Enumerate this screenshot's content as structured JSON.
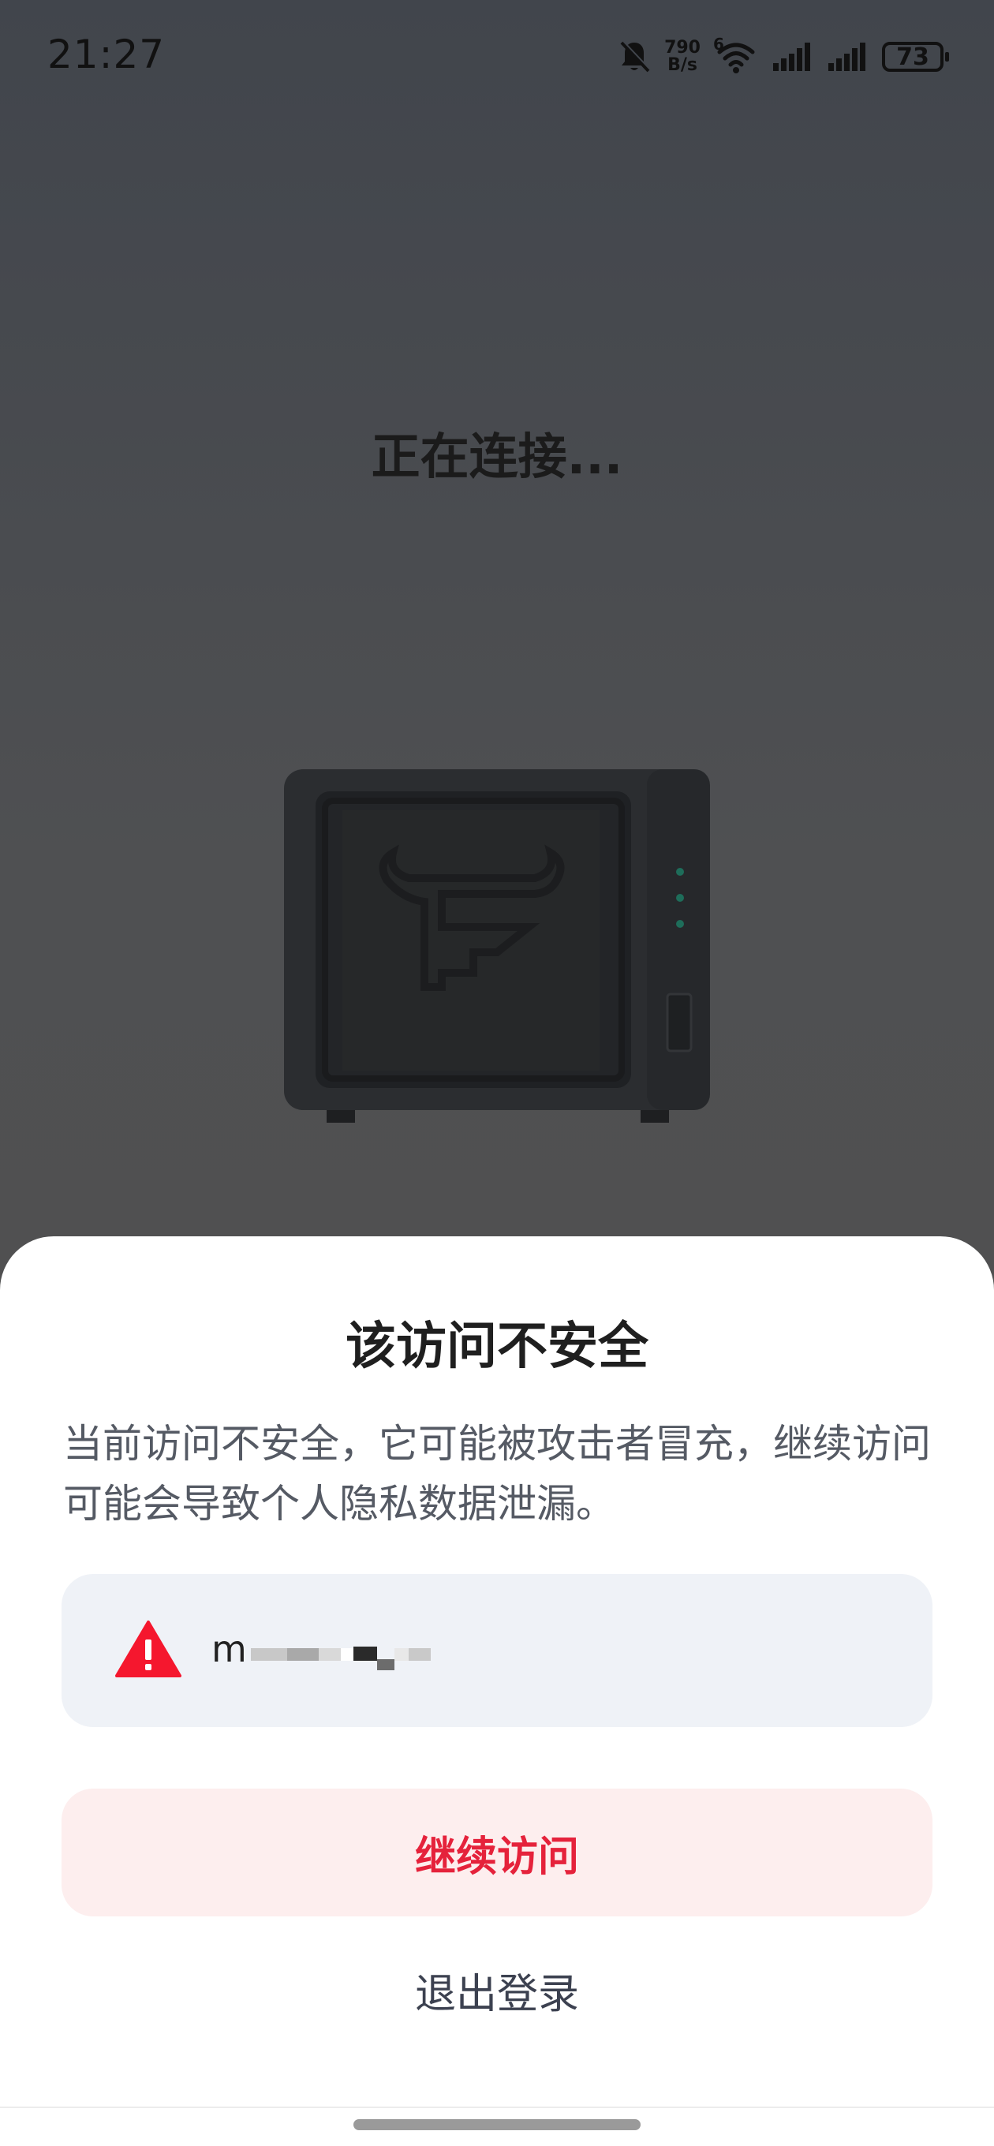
{
  "status_bar": {
    "time": "21:27",
    "net_speed_value": "790",
    "net_speed_unit": "B/s",
    "wifi_label": "6",
    "battery": "73"
  },
  "main": {
    "connecting_text": "正在连接..."
  },
  "dialog": {
    "title": "该访问不安全",
    "description": "当前访问不安全，它可能被攻击者冒充，继续访问可能会导致个人隐私数据泄漏。",
    "url_prefix": "m",
    "continue_label": "继续访问",
    "logout_label": "退出登录"
  },
  "colors": {
    "accent_red": "#e5223b",
    "warning_red": "#f5172e",
    "continue_bg": "#fdeeee",
    "url_card_bg": "#eff2f7"
  }
}
